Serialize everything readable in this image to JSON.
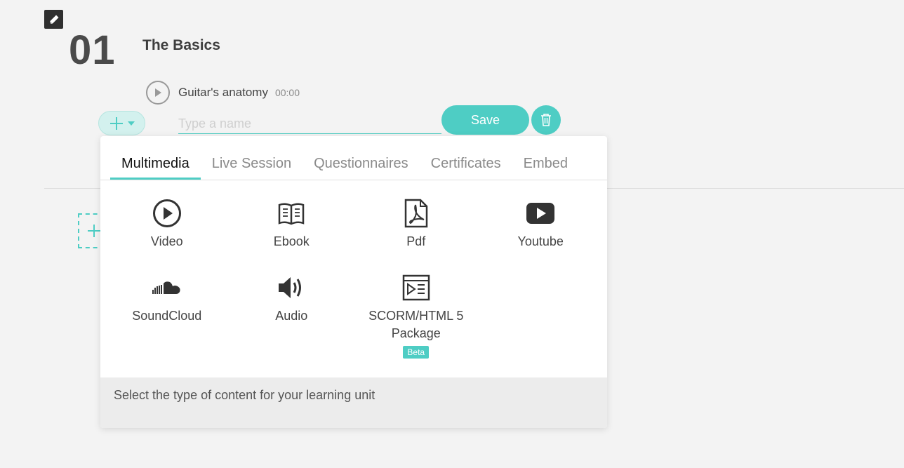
{
  "section": {
    "number": "01",
    "title": "The Basics"
  },
  "lesson": {
    "name": "Guitar's anatomy",
    "duration": "00:00"
  },
  "editor": {
    "name_placeholder": "Type a name",
    "name_value": "",
    "save_label": "Save"
  },
  "popup": {
    "tabs": [
      {
        "label": "Multimedia",
        "active": true
      },
      {
        "label": "Live Session",
        "active": false
      },
      {
        "label": "Questionnaires",
        "active": false
      },
      {
        "label": "Certificates",
        "active": false
      },
      {
        "label": "Embed",
        "active": false
      }
    ],
    "items": [
      {
        "label": "Video",
        "icon": "play-circle-icon"
      },
      {
        "label": "Ebook",
        "icon": "book-icon"
      },
      {
        "label": "Pdf",
        "icon": "pdf-icon"
      },
      {
        "label": "Youtube",
        "icon": "youtube-icon"
      },
      {
        "label": "SoundCloud",
        "icon": "soundcloud-icon"
      },
      {
        "label": "Audio",
        "icon": "speaker-icon"
      },
      {
        "label": "SCORM/HTML 5 Package",
        "icon": "scorm-icon",
        "badge": "Beta"
      }
    ],
    "footer_text": "Select the type of content for your learning unit"
  },
  "colors": {
    "accent": "#4ecdc4",
    "background": "#f3f3f3",
    "text": "#444444"
  }
}
